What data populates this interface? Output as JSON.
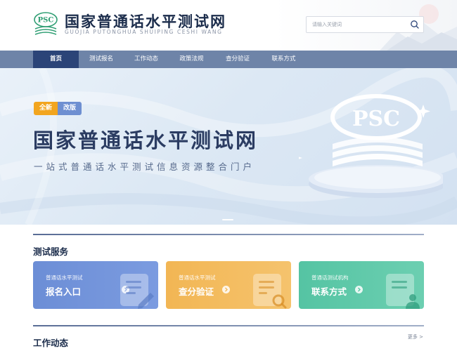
{
  "header": {
    "logo_text": "PSC",
    "title": "国家普通话水平测试网",
    "subtitle": "GUOJIA PUTONGHUA SHUIPING CESHI WANG",
    "search": {
      "placeholder": "请输入关键词",
      "value": ""
    }
  },
  "nav": {
    "items": [
      {
        "label": "首页",
        "active": true
      },
      {
        "label": "测试报名",
        "active": false
      },
      {
        "label": "工作动态",
        "active": false
      },
      {
        "label": "政策法规",
        "active": false
      },
      {
        "label": "查分验证",
        "active": false
      },
      {
        "label": "联系方式",
        "active": false
      }
    ]
  },
  "banner": {
    "badge_new": "全新",
    "badge_revised": "改版",
    "title": "国家普通话水平测试网",
    "subtitle": "一站式普通话水平测试信息资源整合门户",
    "emblem_text": "PSC",
    "active_slide": 1
  },
  "services": {
    "title": "测试服务",
    "cards": [
      {
        "small": "普通话水平测试",
        "big": "报名入口",
        "color": "#6c8ed6"
      },
      {
        "small": "普通话水平测试",
        "big": "查分验证",
        "color": "#f2b654"
      },
      {
        "small": "普通话测试机构",
        "big": "联系方式",
        "color": "#55c4a3"
      }
    ]
  },
  "news": {
    "title": "工作动态",
    "more": "更多 >"
  },
  "colors": {
    "nav_bg": "#6e84a8",
    "nav_active": "#2b4478",
    "title_dark": "#1b2c4b",
    "logo_green": "#2f9e73"
  }
}
